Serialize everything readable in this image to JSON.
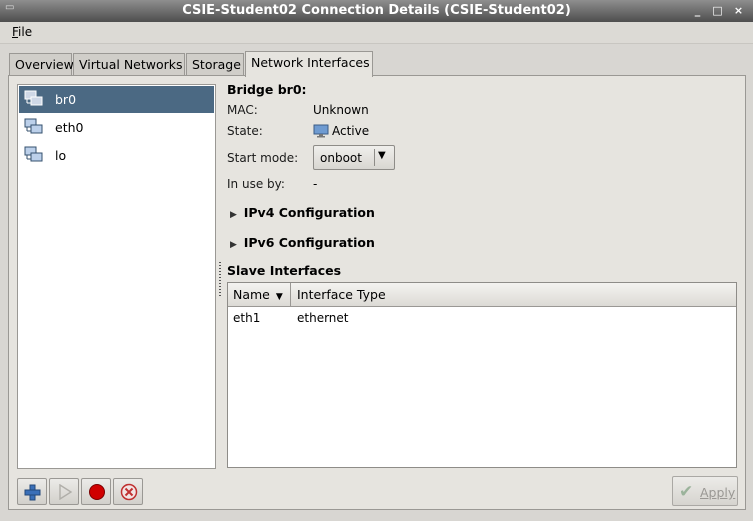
{
  "window": {
    "title": "CSIE-Student02 Connection Details (CSIE-Student02)",
    "controls": {
      "minimize": "_",
      "maximize": "□",
      "close": "×"
    }
  },
  "menubar": {
    "file": "File"
  },
  "tabs": [
    {
      "label": "Overview"
    },
    {
      "label": "Virtual Networks"
    },
    {
      "label": "Storage"
    },
    {
      "label": "Network Interfaces",
      "active": true
    }
  ],
  "interfaces": [
    {
      "name": "br0",
      "selected": true
    },
    {
      "name": "eth0"
    },
    {
      "name": "lo"
    }
  ],
  "details": {
    "heading": "Bridge br0:",
    "mac_label": "MAC:",
    "mac_value": "Unknown",
    "state_label": "State:",
    "state_value": "Active",
    "start_mode_label": "Start mode:",
    "start_mode_value": "onboot",
    "in_use_label": "In use by:",
    "in_use_value": "-",
    "ipv4_label": "IPv4 Configuration",
    "ipv6_label": "IPv6 Configuration",
    "slave_label": "Slave Interfaces"
  },
  "slave_table": {
    "columns": [
      "Name",
      "Interface Type"
    ],
    "rows": [
      {
        "name": "eth1",
        "type": "ethernet"
      }
    ]
  },
  "buttons": {
    "apply": "Apply"
  },
  "colors": {
    "selection": "#4b6983",
    "add": "#3a6fb8",
    "stop": "#d00000",
    "delete": "#c03030"
  }
}
